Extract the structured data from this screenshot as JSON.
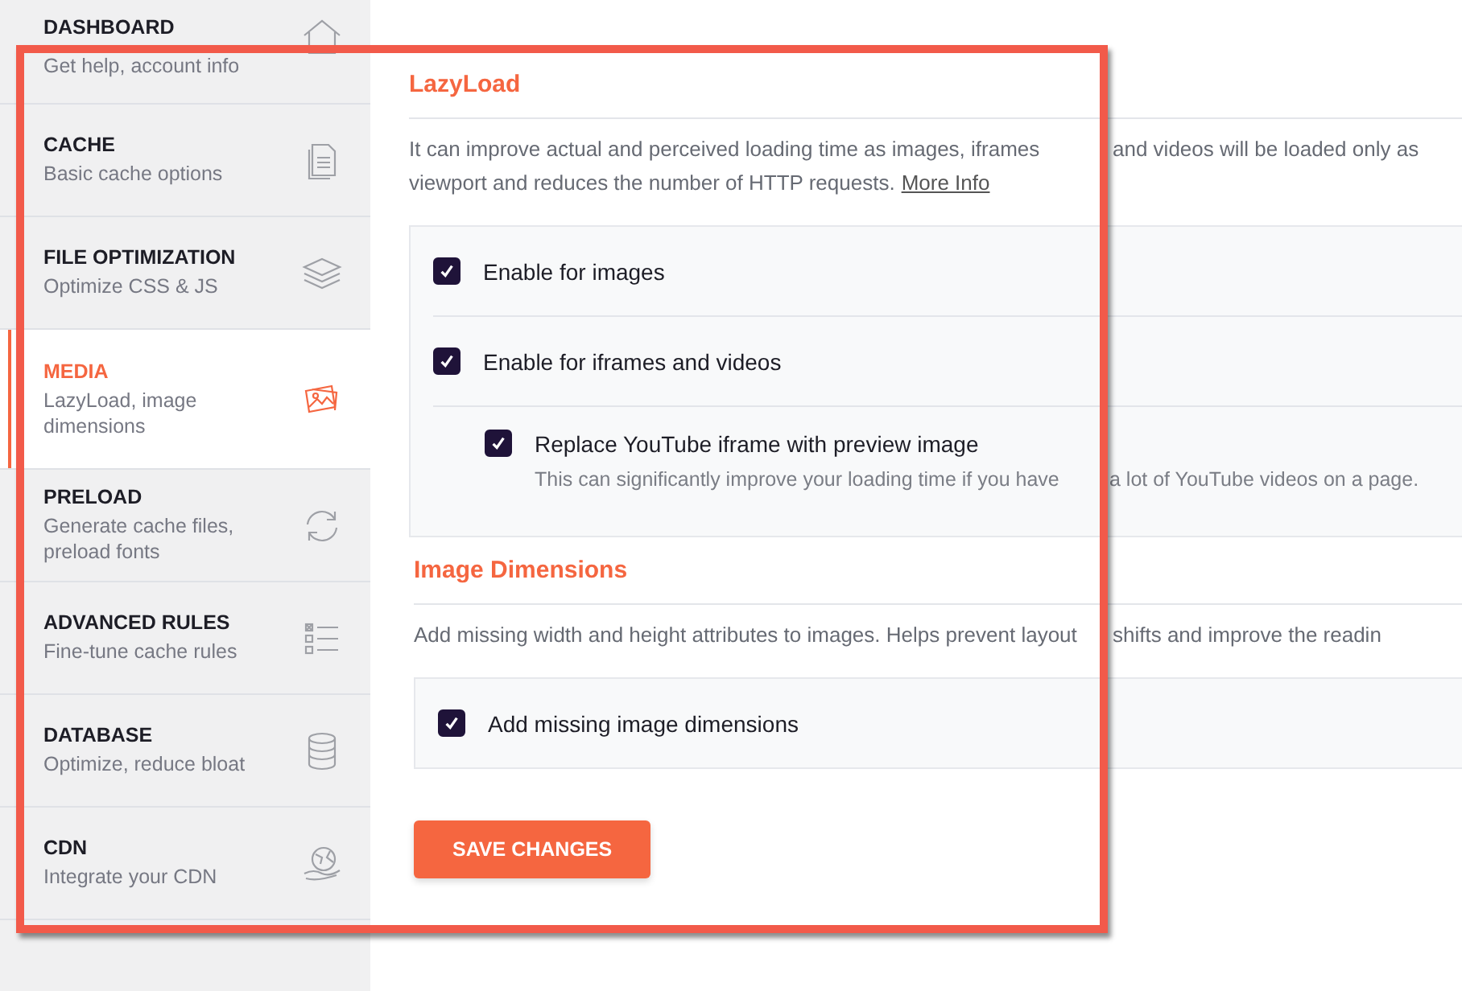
{
  "sidebar": {
    "items": [
      {
        "title": "DASHBOARD",
        "subtitle": "Get help, account info",
        "selected": false
      },
      {
        "title": "CACHE",
        "subtitle": "Basic cache options",
        "selected": false
      },
      {
        "title": "FILE OPTIMIZATION",
        "subtitle": "Optimize CSS & JS",
        "selected": false
      },
      {
        "title": "MEDIA",
        "subtitle": "LazyLoad, image dimensions",
        "selected": true
      },
      {
        "title": "PRELOAD",
        "subtitle": "Generate cache files, preload fonts",
        "selected": false
      },
      {
        "title": "ADVANCED RULES",
        "subtitle": "Fine-tune cache rules",
        "selected": false
      },
      {
        "title": "DATABASE",
        "subtitle": "Optimize, reduce bloat",
        "selected": false
      },
      {
        "title": "CDN",
        "subtitle": "Integrate your CDN",
        "selected": false
      }
    ]
  },
  "sections": [
    {
      "heading": "LazyLoad",
      "description_lines": [
        [
          "It can improve actual and perceived loading time as images, iframes",
          "and videos will be loaded only as"
        ],
        [
          "viewport and reduces the number of HTTP requests."
        ]
      ],
      "link": "More Info",
      "options": [
        {
          "label": "Enable for images",
          "checked": true
        },
        {
          "label": "Enable for iframes and videos",
          "checked": true,
          "children": [
            {
              "label": "Replace YouTube iframe with preview image",
              "checked": true,
              "note": [
                "This can significantly improve your loading time if you have",
                "a lot of YouTube videos on a page."
              ]
            }
          ]
        }
      ]
    },
    {
      "heading": "Image Dimensions",
      "description_lines": [
        [
          "Add missing width and height attributes to images. Helps prevent layout",
          "shifts and improve the readin"
        ]
      ],
      "options": [
        {
          "label": "Add missing image dimensions",
          "checked": true
        }
      ]
    }
  ],
  "save_button": "SAVE CHANGES"
}
